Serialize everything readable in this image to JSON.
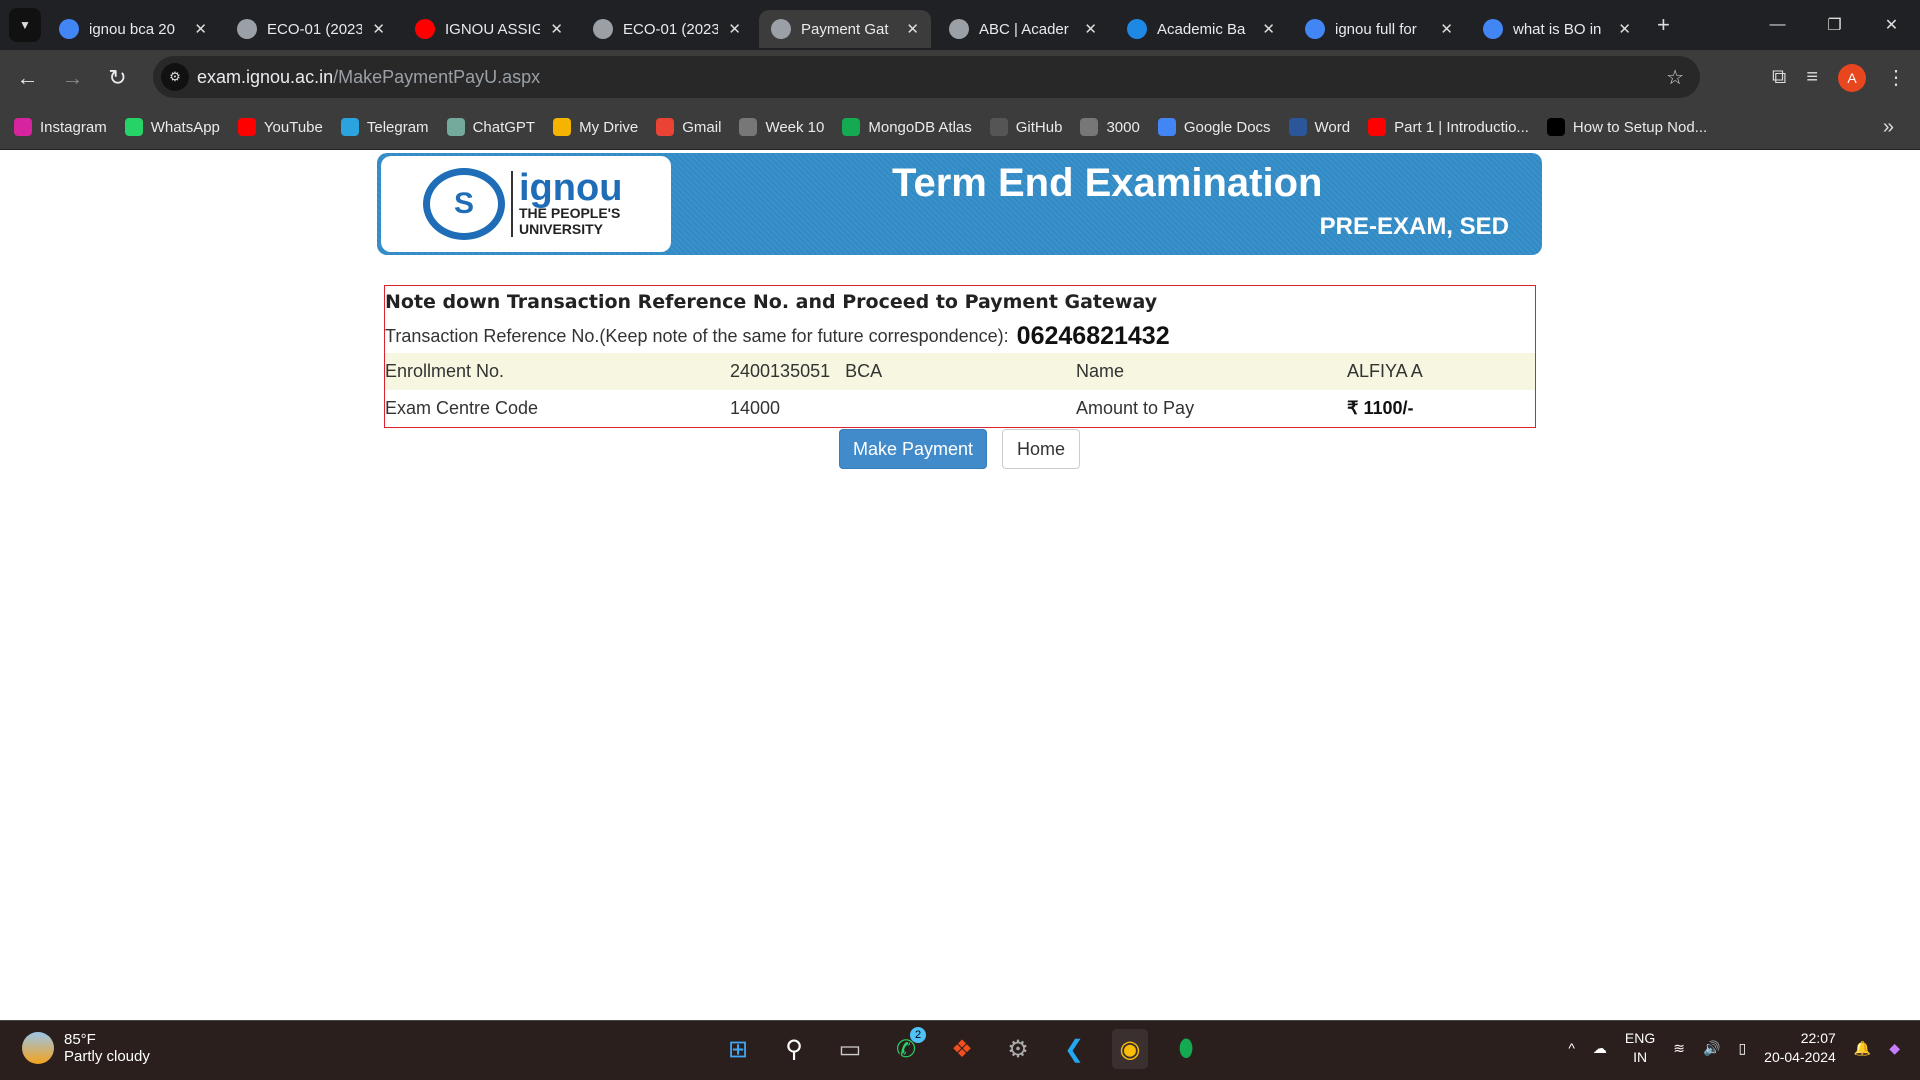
{
  "browser": {
    "tabs": [
      {
        "title": "ignou bca 20",
        "icon": "google-icon",
        "color": "#4285f4",
        "active": false
      },
      {
        "title": "ECO-01 (2023",
        "icon": "globe-icon",
        "color": "#9aa0a6",
        "active": false
      },
      {
        "title": "IGNOU ASSIG",
        "icon": "youtube-icon",
        "color": "#ff0000",
        "active": false
      },
      {
        "title": "ECO-01 (2023",
        "icon": "globe-icon",
        "color": "#9aa0a6",
        "active": false
      },
      {
        "title": "Payment Gat",
        "icon": "globe-icon",
        "color": "#9aa0a6",
        "active": true
      },
      {
        "title": "ABC | Acader",
        "icon": "globe-icon",
        "color": "#9aa0a6",
        "active": false
      },
      {
        "title": "Academic Ba",
        "icon": "abc-icon",
        "color": "#1e88e5",
        "active": false
      },
      {
        "title": "ignou full for",
        "icon": "google-icon",
        "color": "#4285f4",
        "active": false
      },
      {
        "title": "what is BO in",
        "icon": "google-icon",
        "color": "#4285f4",
        "active": false
      }
    ],
    "url_host": "exam.ignou.ac.in",
    "url_path": "/MakePaymentPayU.aspx",
    "profile_initial": "A",
    "bookmarks": [
      {
        "label": "Instagram",
        "color": "#d6249f"
      },
      {
        "label": "WhatsApp",
        "color": "#25d366"
      },
      {
        "label": "YouTube",
        "color": "#ff0000"
      },
      {
        "label": "Telegram",
        "color": "#2aa3df"
      },
      {
        "label": "ChatGPT",
        "color": "#74aa9c"
      },
      {
        "label": "My Drive",
        "color": "#f4b400"
      },
      {
        "label": "Gmail",
        "color": "#ea4335"
      },
      {
        "label": "Week 10",
        "color": "#777"
      },
      {
        "label": "MongoDB Atlas",
        "color": "#13aa52"
      },
      {
        "label": "GitHub",
        "color": "#555"
      },
      {
        "label": "3000",
        "color": "#777"
      },
      {
        "label": "Google Docs",
        "color": "#4285f4"
      },
      {
        "label": "Word",
        "color": "#2b579a"
      },
      {
        "label": "Part 1 | Introductio...",
        "color": "#ff0000"
      },
      {
        "label": "How to Setup Nod...",
        "color": "#000"
      }
    ]
  },
  "banner": {
    "logo_text": "ignou",
    "logo_sub1": "THE PEOPLE'S",
    "logo_sub2": "UNIVERSITY",
    "title": "Term End Examination",
    "subtitle": "PRE-EXAM, SED"
  },
  "info": {
    "heading": "Note down Transaction Reference No. and Proceed to Payment Gateway",
    "ref_label": "Transaction Reference No.(Keep note of the same for future correspondence):",
    "ref_value": "06246821432",
    "enroll_label": "Enrollment No.",
    "enroll_value": "2400135051   BCA",
    "name_label": "Name",
    "name_value": "ALFIYA A",
    "centre_label": "Exam Centre Code",
    "centre_value": "14000",
    "amount_label": "Amount to Pay",
    "amount_value": "₹ 1100/-"
  },
  "buttons": {
    "pay": "Make Payment",
    "home": "Home"
  },
  "taskbar": {
    "temp": "85°F",
    "weather": "Partly cloudy",
    "whatsapp_badge": "2",
    "lang1": "ENG",
    "lang2": "IN",
    "time": "22:07",
    "date": "20-04-2024"
  }
}
